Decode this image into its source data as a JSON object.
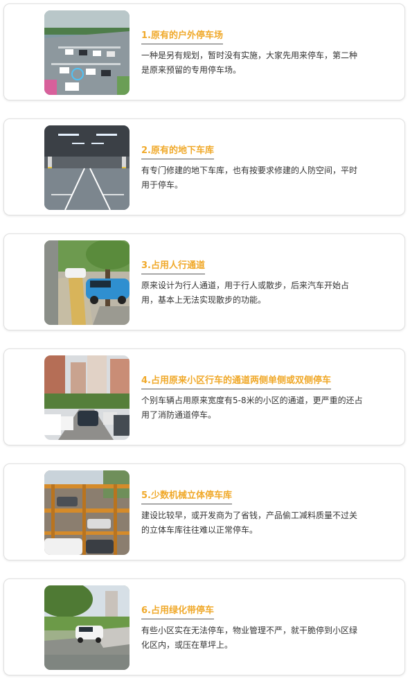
{
  "colors": {
    "title_accent": "#f0a92a",
    "body_text": "#333333",
    "card_border": "#e0e0e0"
  },
  "cards": [
    {
      "title": "1.原有的户外停车场",
      "desc": "一种是另有规划，暂时没有实施，大家先用来停车，第二种是原来预留的专用停车场。",
      "image": "outdoor-parking-lot-photo"
    },
    {
      "title": "2.原有的地下车库",
      "desc": "有专门修建的地下车库，也有按要求修建的人防空间，平时用于停车。",
      "image": "underground-garage-photo"
    },
    {
      "title": "3.占用人行通道",
      "desc": "原来设计为行人通道，用于行人或散步，后来汽车开始占用，基本上无法实现散步的功能。",
      "image": "sidewalk-parking-photo"
    },
    {
      "title": "4.占用原来小区行车的通道两侧单侧或双侧停车",
      "desc": "个别车辆占用原来宽度有5-8米的小区的通道，更严重的还占用了消防通道停车。",
      "image": "residential-road-parking-photo"
    },
    {
      "title": "5.少数机械立体停车库",
      "desc": "建设比较早，或开发商为了省钱，产品偷工减料质量不过关的立体车库往往难以正常停车。",
      "image": "mechanical-stacker-garage-photo"
    },
    {
      "title": "6.占用绿化带停车",
      "desc": "有些小区实在无法停车，物业管理不严，就干脆停到小区绿化区内，或压在草坪上。",
      "image": "green-belt-parking-photo"
    }
  ]
}
